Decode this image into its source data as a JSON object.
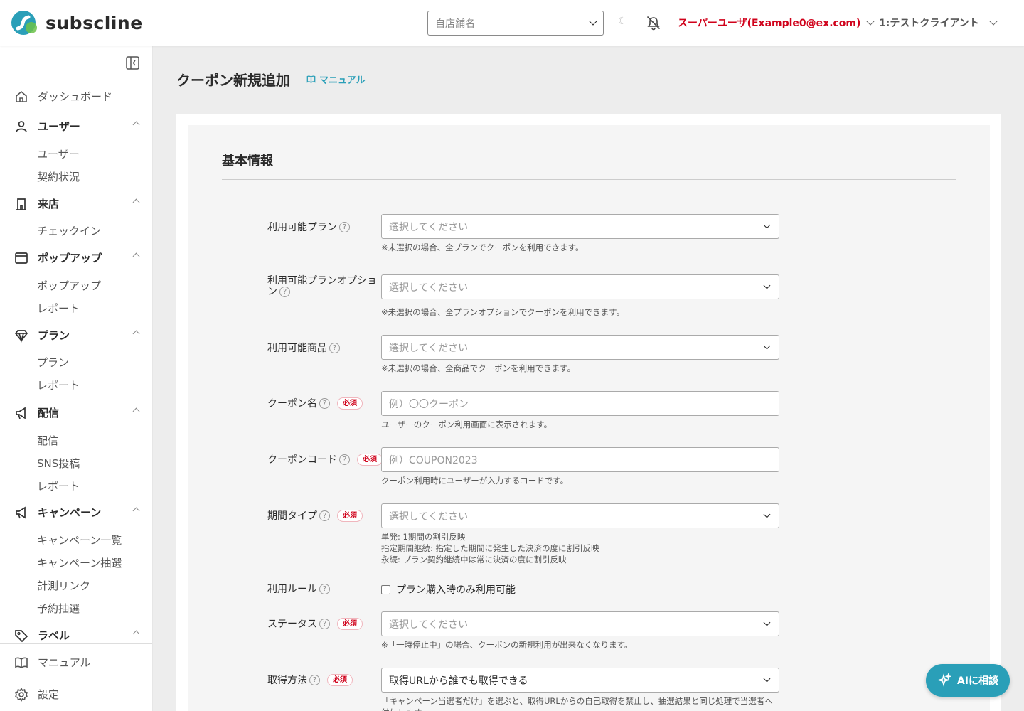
{
  "brand": {
    "name": "subscline",
    "accent": "#2a9fb8",
    "danger": "#d0021b"
  },
  "header": {
    "store_placeholder": "自店舗名",
    "theme_icon": "moon-icon",
    "user": "スーパーユーザ(Example0@ex.com)",
    "client": "1:テストクライアント"
  },
  "sidebar": {
    "dashboard": "ダッシュボード",
    "sections": [
      {
        "label": "ユーザー",
        "icon": "user-icon",
        "items": [
          "ユーザー",
          "契約状況"
        ]
      },
      {
        "label": "来店",
        "icon": "building-icon",
        "items": [
          "チェックイン"
        ]
      },
      {
        "label": "ポップアップ",
        "icon": "window-icon",
        "items": [
          "ポップアップ",
          "レポート"
        ]
      },
      {
        "label": "プラン",
        "icon": "diamond-icon",
        "items": [
          "プラン",
          "レポート"
        ]
      },
      {
        "label": "配信",
        "icon": "megaphone-icon",
        "items": [
          "配信",
          "SNS投稿",
          "レポート"
        ]
      },
      {
        "label": "キャンペーン",
        "icon": "megaphone-icon",
        "items": [
          "キャンペーン一覧",
          "キャンペーン抽選",
          "計測リンク",
          "予約抽選"
        ]
      },
      {
        "label": "ラベル",
        "icon": "tag-icon",
        "items": []
      }
    ],
    "bottom": {
      "manual": "マニュアル",
      "settings": "設定"
    }
  },
  "page": {
    "title": "クーポン新規追加",
    "manual_link": "マニュアル"
  },
  "form": {
    "section_title": "基本情報",
    "required_badge": "必須",
    "plan": {
      "label": "利用可能プラン",
      "placeholder": "選択してください",
      "hint": "※未選択の場合、全プランでクーポンを利用できます。"
    },
    "plan_option": {
      "label": "利用可能プランオプション",
      "placeholder": "選択してください",
      "hint": "※未選択の場合、全プランオプションでクーポンを利用できます。"
    },
    "product": {
      "label": "利用可能商品",
      "placeholder": "選択してください",
      "hint": "※未選択の場合、全商品でクーポンを利用できます。"
    },
    "coupon_name": {
      "label": "クーポン名",
      "placeholder": "例）〇〇クーポン",
      "hint": "ユーザーのクーポン利用画面に表示されます。"
    },
    "coupon_code": {
      "label": "クーポンコード",
      "placeholder": "例）COUPON2023",
      "hint": "クーポン利用時にユーザーが入力するコードです。"
    },
    "period_type": {
      "label": "期間タイプ",
      "placeholder": "選択してください",
      "hints": [
        "単発: 1期間の割引反映",
        "指定期間継続: 指定した期間に発生した決済の度に割引反映",
        "永続: プラン契約継続中は常に決済の度に割引反映"
      ]
    },
    "usage_rule": {
      "label": "利用ルール",
      "checkbox_label": "プラン購入時のみ利用可能",
      "checked": false
    },
    "status": {
      "label": "ステータス",
      "placeholder": "選択してください",
      "hint": "※「一時停止中」の場合、クーポンの新規利用が出来なくなります。"
    },
    "acquisition": {
      "label": "取得方法",
      "value": "取得URLから誰でも取得できる",
      "hint": "「キャンペーン当選者だけ」を選ぶと、取得URLからの自己取得を禁止し、抽選結果と同じ処理で当選者へ付与します。"
    }
  },
  "ai_button": "AIに相談"
}
